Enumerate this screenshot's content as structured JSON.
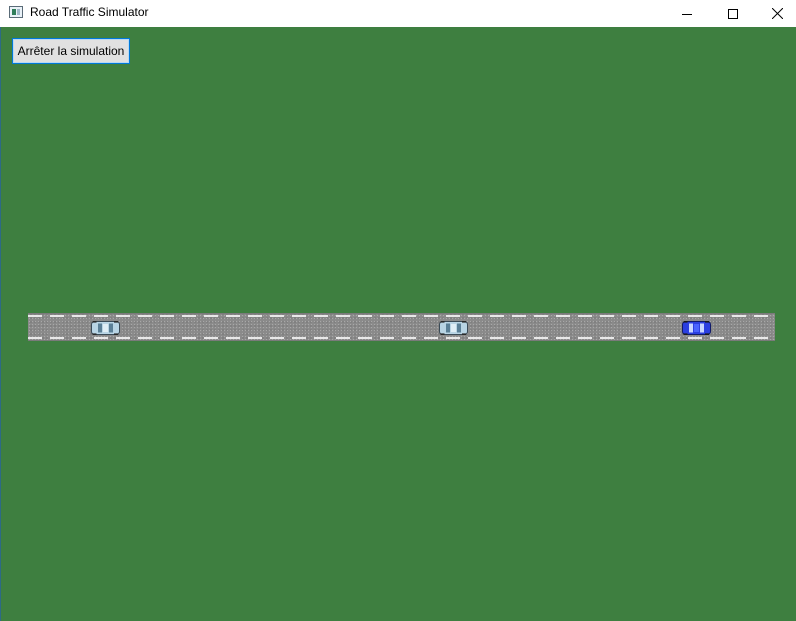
{
  "window": {
    "title": "Road Traffic Simulator",
    "icon": "app-icon",
    "controls": {
      "minimize_icon": "minimize-icon",
      "maximize_icon": "maximize-icon",
      "close_icon": "close-icon"
    }
  },
  "toolbar": {
    "stop_label": "Arrêter la simulation"
  },
  "scene": {
    "background_color": "#3e7f40",
    "road_color": "#8a8a8a",
    "lane_marking_color": "#e8e8e8",
    "cars": [
      {
        "name": "car-1",
        "color": "#b8d4e4",
        "icon": "car-icon"
      },
      {
        "name": "car-2",
        "color": "#b8d4e4",
        "icon": "car-icon"
      },
      {
        "name": "car-3",
        "color": "#2b3fe0",
        "icon": "car-icon"
      }
    ]
  }
}
